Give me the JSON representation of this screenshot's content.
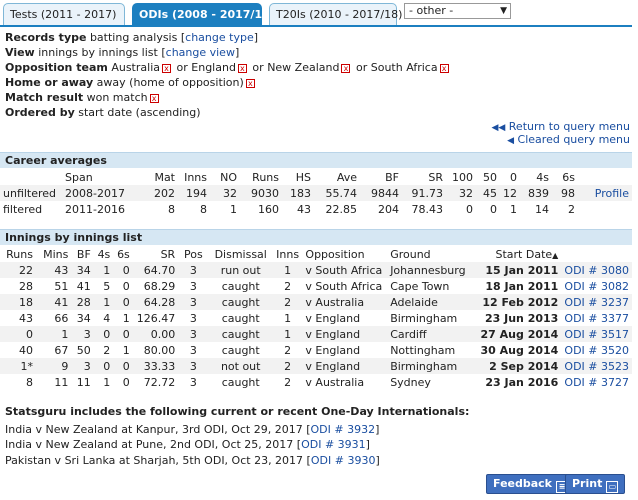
{
  "tabs": [
    {
      "label": "Tests (2011 - 2017)"
    },
    {
      "label": "ODIs (2008 - 2017/18)"
    },
    {
      "label": "T20Is (2010 - 2017/18)"
    }
  ],
  "other_select": "- other -",
  "criteria": {
    "records_type_label": "Records type",
    "records_type_value": "batting analysis",
    "change_type": "change type",
    "view_label": "View",
    "view_value": "innings by innings list",
    "change_view": "change view",
    "opposition_label": "Opposition team",
    "opposition_teams": [
      "Australia",
      "England",
      "New Zealand",
      "South Africa"
    ],
    "or": "or",
    "home_label": "Home or away",
    "home_value": "away (home of opposition)",
    "result_label": "Match result",
    "result_value": "won match",
    "ordered_label": "Ordered by",
    "ordered_value": "start date (ascending)"
  },
  "links": {
    "return_query": "Return to query menu",
    "cleared_query": "Cleared query menu"
  },
  "career": {
    "title": "Career averages",
    "headers": [
      "",
      "Span",
      "Mat",
      "Inns",
      "NO",
      "Runs",
      "HS",
      "Ave",
      "BF",
      "SR",
      "100",
      "50",
      "0",
      "4s",
      "6s",
      ""
    ],
    "rows": [
      [
        "unfiltered",
        "2008-2017",
        "202",
        "194",
        "32",
        "9030",
        "183",
        "55.74",
        "9844",
        "91.73",
        "32",
        "45",
        "12",
        "839",
        "98",
        "Profile"
      ],
      [
        "filtered",
        "2011-2016",
        "8",
        "8",
        "1",
        "160",
        "43",
        "22.85",
        "204",
        "78.43",
        "0",
        "0",
        "1",
        "14",
        "2",
        ""
      ]
    ]
  },
  "innings": {
    "title": "Innings by innings list",
    "headers": [
      "Runs",
      "Mins",
      "BF",
      "4s",
      "6s",
      "SR",
      "Pos",
      "Dismissal",
      "Inns",
      "Opposition",
      "Ground",
      "Start Date",
      ""
    ],
    "rows": [
      [
        "22",
        "43",
        "34",
        "1",
        "0",
        "64.70",
        "3",
        "run out",
        "1",
        "v South Africa",
        "Johannesburg",
        "15 Jan 2011",
        "ODI # 3080"
      ],
      [
        "28",
        "51",
        "41",
        "5",
        "0",
        "68.29",
        "3",
        "caught",
        "2",
        "v South Africa",
        "Cape Town",
        "18 Jan 2011",
        "ODI # 3082"
      ],
      [
        "18",
        "41",
        "28",
        "1",
        "0",
        "64.28",
        "3",
        "caught",
        "2",
        "v Australia",
        "Adelaide",
        "12 Feb 2012",
        "ODI # 3237"
      ],
      [
        "43",
        "66",
        "34",
        "4",
        "1",
        "126.47",
        "3",
        "caught",
        "1",
        "v England",
        "Birmingham",
        "23 Jun 2013",
        "ODI # 3377"
      ],
      [
        "0",
        "1",
        "3",
        "0",
        "0",
        "0.00",
        "3",
        "caught",
        "1",
        "v England",
        "Cardiff",
        "27 Aug 2014",
        "ODI # 3517"
      ],
      [
        "40",
        "67",
        "50",
        "2",
        "1",
        "80.00",
        "3",
        "caught",
        "2",
        "v England",
        "Nottingham",
        "30 Aug 2014",
        "ODI # 3520"
      ],
      [
        "1*",
        "9",
        "3",
        "0",
        "0",
        "33.33",
        "3",
        "not out",
        "2",
        "v England",
        "Birmingham",
        "2 Sep 2014",
        "ODI # 3523"
      ],
      [
        "8",
        "11",
        "11",
        "1",
        "0",
        "72.72",
        "3",
        "caught",
        "2",
        "v Australia",
        "Sydney",
        "23 Jan 2016",
        "ODI # 3727"
      ]
    ]
  },
  "footer": {
    "title": "Statsguru includes the following current or recent One-Day Internationals:",
    "items": [
      {
        "text": "India v New Zealand at Kanpur, 3rd ODI, Oct 29, 2017",
        "link": "ODI # 3932"
      },
      {
        "text": "India v New Zealand at Pune, 2nd ODI, Oct 25, 2017",
        "link": "ODI # 3931"
      },
      {
        "text": "Pakistan v Sri Lanka at Sharjah, 5th ODI, Oct 23, 2017",
        "link": "ODI # 3930"
      }
    ]
  },
  "buttons": {
    "feedback": "Feedback",
    "print": "Print"
  }
}
